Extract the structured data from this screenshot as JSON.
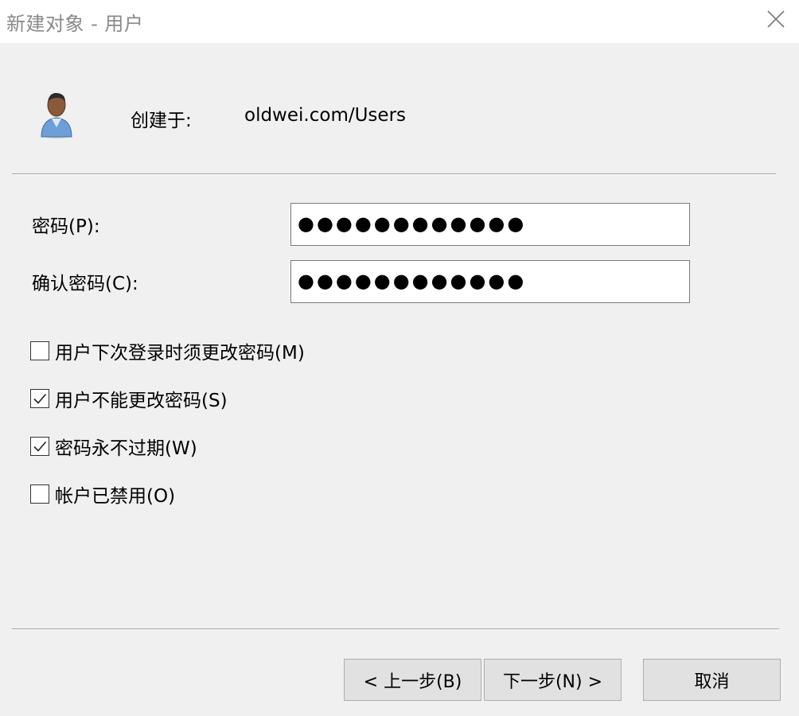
{
  "window": {
    "title": "新建对象 - 用户"
  },
  "header": {
    "created_in_label": "创建于:",
    "created_in_value": "oldwei.com/Users"
  },
  "fields": {
    "password": {
      "label": "密码(P):",
      "value": "●●●●●●●●●●●●"
    },
    "confirm_password": {
      "label": "确认密码(C):",
      "value": "●●●●●●●●●●●●"
    }
  },
  "options": [
    {
      "label": "用户下次登录时须更改密码(M)",
      "checked": false
    },
    {
      "label": "用户不能更改密码(S)",
      "checked": true
    },
    {
      "label": "密码永不过期(W)",
      "checked": true
    },
    {
      "label": "帐户已禁用(O)",
      "checked": false
    }
  ],
  "buttons": {
    "back": "< 上一步(B)",
    "next": "下一步(N) >",
    "cancel": "取消"
  }
}
